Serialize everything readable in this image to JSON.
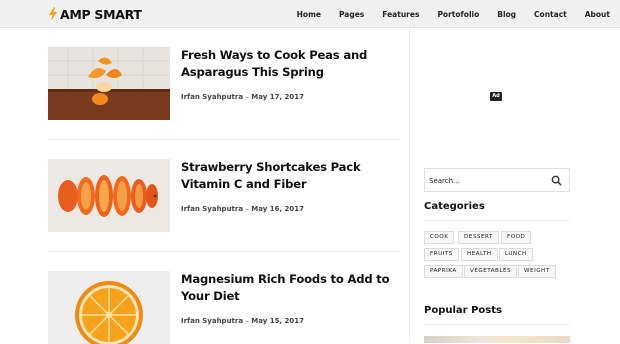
{
  "brand": {
    "name": "AMP SMART",
    "bolt_color": "#f7a21b"
  },
  "nav": {
    "items": [
      {
        "label": "Home"
      },
      {
        "label": "Pages"
      },
      {
        "label": "Features"
      },
      {
        "label": "Portofolio"
      },
      {
        "label": "Blog"
      },
      {
        "label": "Contact"
      },
      {
        "label": "About"
      }
    ]
  },
  "posts": [
    {
      "title": "Fresh Ways to Cook Peas and Asparagus This Spring",
      "author": "Irfan Syahputra",
      "date": "May 17, 2017",
      "image": "peeled-orange-icon"
    },
    {
      "title": "Strawberry Shortcakes Pack Vitamin C and Fiber",
      "author": "Irfan Syahputra",
      "date": "May 16, 2017",
      "image": "sliced-orange-icon"
    },
    {
      "title": "Magnesium Rich Foods to Add to Your Diet",
      "author": "Irfan Syahputra",
      "date": "May 15, 2017",
      "image": "orange-half-icon"
    }
  ],
  "meta_separator": "–",
  "ad": {
    "label": "Ad"
  },
  "search": {
    "placeholder": "Search..."
  },
  "categories": {
    "title": "Categories",
    "tags": [
      "COOK",
      "DESSERT",
      "FOOD",
      "FRUITS",
      "HEALTH",
      "LUNCH",
      "PAPRIKA",
      "VEGETABLES",
      "WEIGHT"
    ]
  },
  "popular": {
    "title": "Popular Posts"
  }
}
